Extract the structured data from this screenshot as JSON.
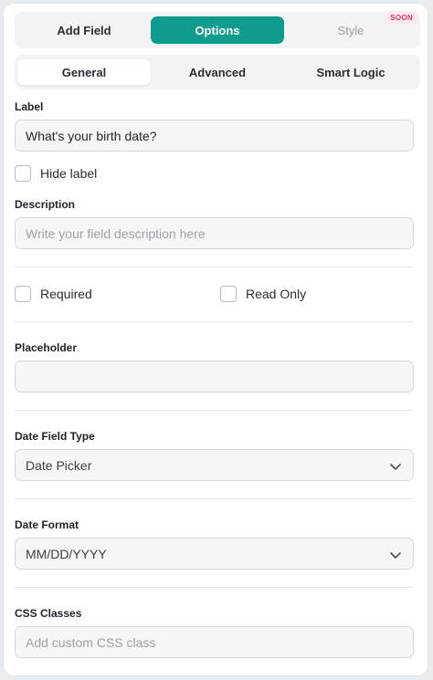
{
  "top_tabs": [
    {
      "label": "Add Field",
      "state": "default"
    },
    {
      "label": "Options",
      "state": "active"
    },
    {
      "label": "Style",
      "state": "disabled",
      "badge": "SOON"
    }
  ],
  "sub_tabs": [
    {
      "label": "General",
      "state": "active"
    },
    {
      "label": "Advanced",
      "state": "default"
    },
    {
      "label": "Smart Logic",
      "state": "default"
    }
  ],
  "label_field": {
    "label": "Label",
    "value": "What's your birth date?"
  },
  "hide_label": {
    "label": "Hide label",
    "checked": false
  },
  "description_field": {
    "label": "Description",
    "placeholder": "Write your field description here"
  },
  "required": {
    "label": "Required",
    "checked": false
  },
  "read_only": {
    "label": "Read Only",
    "checked": false
  },
  "placeholder_field": {
    "label": "Placeholder",
    "value": ""
  },
  "date_field_type": {
    "label": "Date Field Type",
    "selected": "Date Picker"
  },
  "date_format": {
    "label": "Date Format",
    "selected": "MM/DD/YYYY"
  },
  "css_classes": {
    "label": "CSS Classes",
    "placeholder": "Add custom CSS class"
  },
  "colors": {
    "accent": "#0f9b8e",
    "soon_badge_bg": "#fde8ec",
    "soon_badge_text": "#d6366a"
  }
}
